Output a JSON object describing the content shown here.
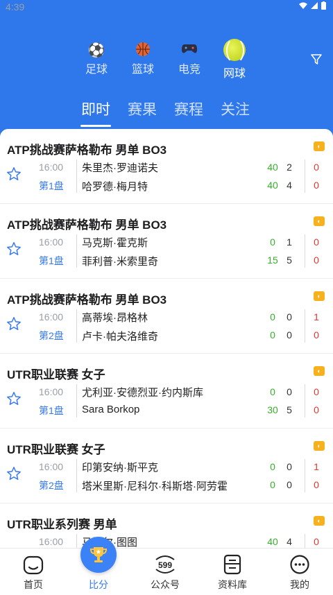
{
  "status": {
    "time": "4:39"
  },
  "sports": [
    {
      "label": "足球",
      "icon": "soccer-ball-icon"
    },
    {
      "label": "篮球",
      "icon": "basketball-icon"
    },
    {
      "label": "电竞",
      "icon": "gamepad-icon"
    },
    {
      "label": "网球",
      "icon": "tennis-ball-icon",
      "active": true
    }
  ],
  "subtabs": [
    "即时",
    "赛果",
    "赛程",
    "关注"
  ],
  "matches": [
    {
      "league": "ATP挑战赛萨格勒布 男单 BO3",
      "time": "16:00",
      "set": "第1盘",
      "p1": {
        "name": "朱里杰·罗迪诺夫",
        "pts": "40",
        "games": "2",
        "sets": "0"
      },
      "p2": {
        "name": "哈罗德·梅月特",
        "pts": "40",
        "games": "4",
        "sets": "0"
      }
    },
    {
      "league": "ATP挑战赛萨格勒布 男单 BO3",
      "time": "16:00",
      "set": "第1盘",
      "p1": {
        "name": "马克斯·霍克斯",
        "pts": "0",
        "games": "1",
        "sets": "0"
      },
      "p2": {
        "name": "菲利普·米索里奇",
        "pts": "15",
        "games": "5",
        "sets": "0"
      }
    },
    {
      "league": "ATP挑战赛萨格勒布 男单 BO3",
      "time": "16:00",
      "set": "第2盘",
      "p1": {
        "name": "高蒂埃·昂格林",
        "pts": "0",
        "games": "0",
        "sets": "1"
      },
      "p2": {
        "name": "卢卡·帕夫洛维奇",
        "pts": "0",
        "games": "0",
        "sets": "0"
      }
    },
    {
      "league": "UTR职业联赛 女子",
      "time": "16:00",
      "set": "第1盘",
      "p1": {
        "name": "尤利亚·安德烈亚·约内斯库",
        "pts": "0",
        "games": "0",
        "sets": "0"
      },
      "p2": {
        "name": "Sara Borkop",
        "pts": "30",
        "games": "5",
        "sets": "0"
      }
    },
    {
      "league": "UTR职业联赛 女子",
      "time": "16:00",
      "set": "第2盘",
      "p1": {
        "name": "印第安纳·斯平克",
        "pts": "0",
        "games": "0",
        "sets": "1"
      },
      "p2": {
        "name": "塔米里斯·尼科尔·科斯塔·阿劳霍",
        "pts": "0",
        "games": "0",
        "sets": "0"
      }
    },
    {
      "league": "UTR职业系列赛 男单",
      "time": "16:00",
      "set": "",
      "p1": {
        "name": "马勒尔·图图",
        "pts": "40",
        "games": "4",
        "sets": "0"
      },
      "p2": {
        "name": "",
        "pts": "",
        "games": "",
        "sets": ""
      }
    }
  ],
  "nav": [
    {
      "label": "首页",
      "icon": "home-icon"
    },
    {
      "label": "比分",
      "icon": "trophy-icon",
      "active": true
    },
    {
      "label": "公众号",
      "icon": "599-logo-icon"
    },
    {
      "label": "资料库",
      "icon": "database-icon"
    },
    {
      "label": "我的",
      "icon": "chat-bubble-icon"
    }
  ],
  "colors": {
    "primary": "#2f78ec",
    "win_points": "#36b02a",
    "sets": "#e2382f",
    "set_label": "#3478f6"
  }
}
